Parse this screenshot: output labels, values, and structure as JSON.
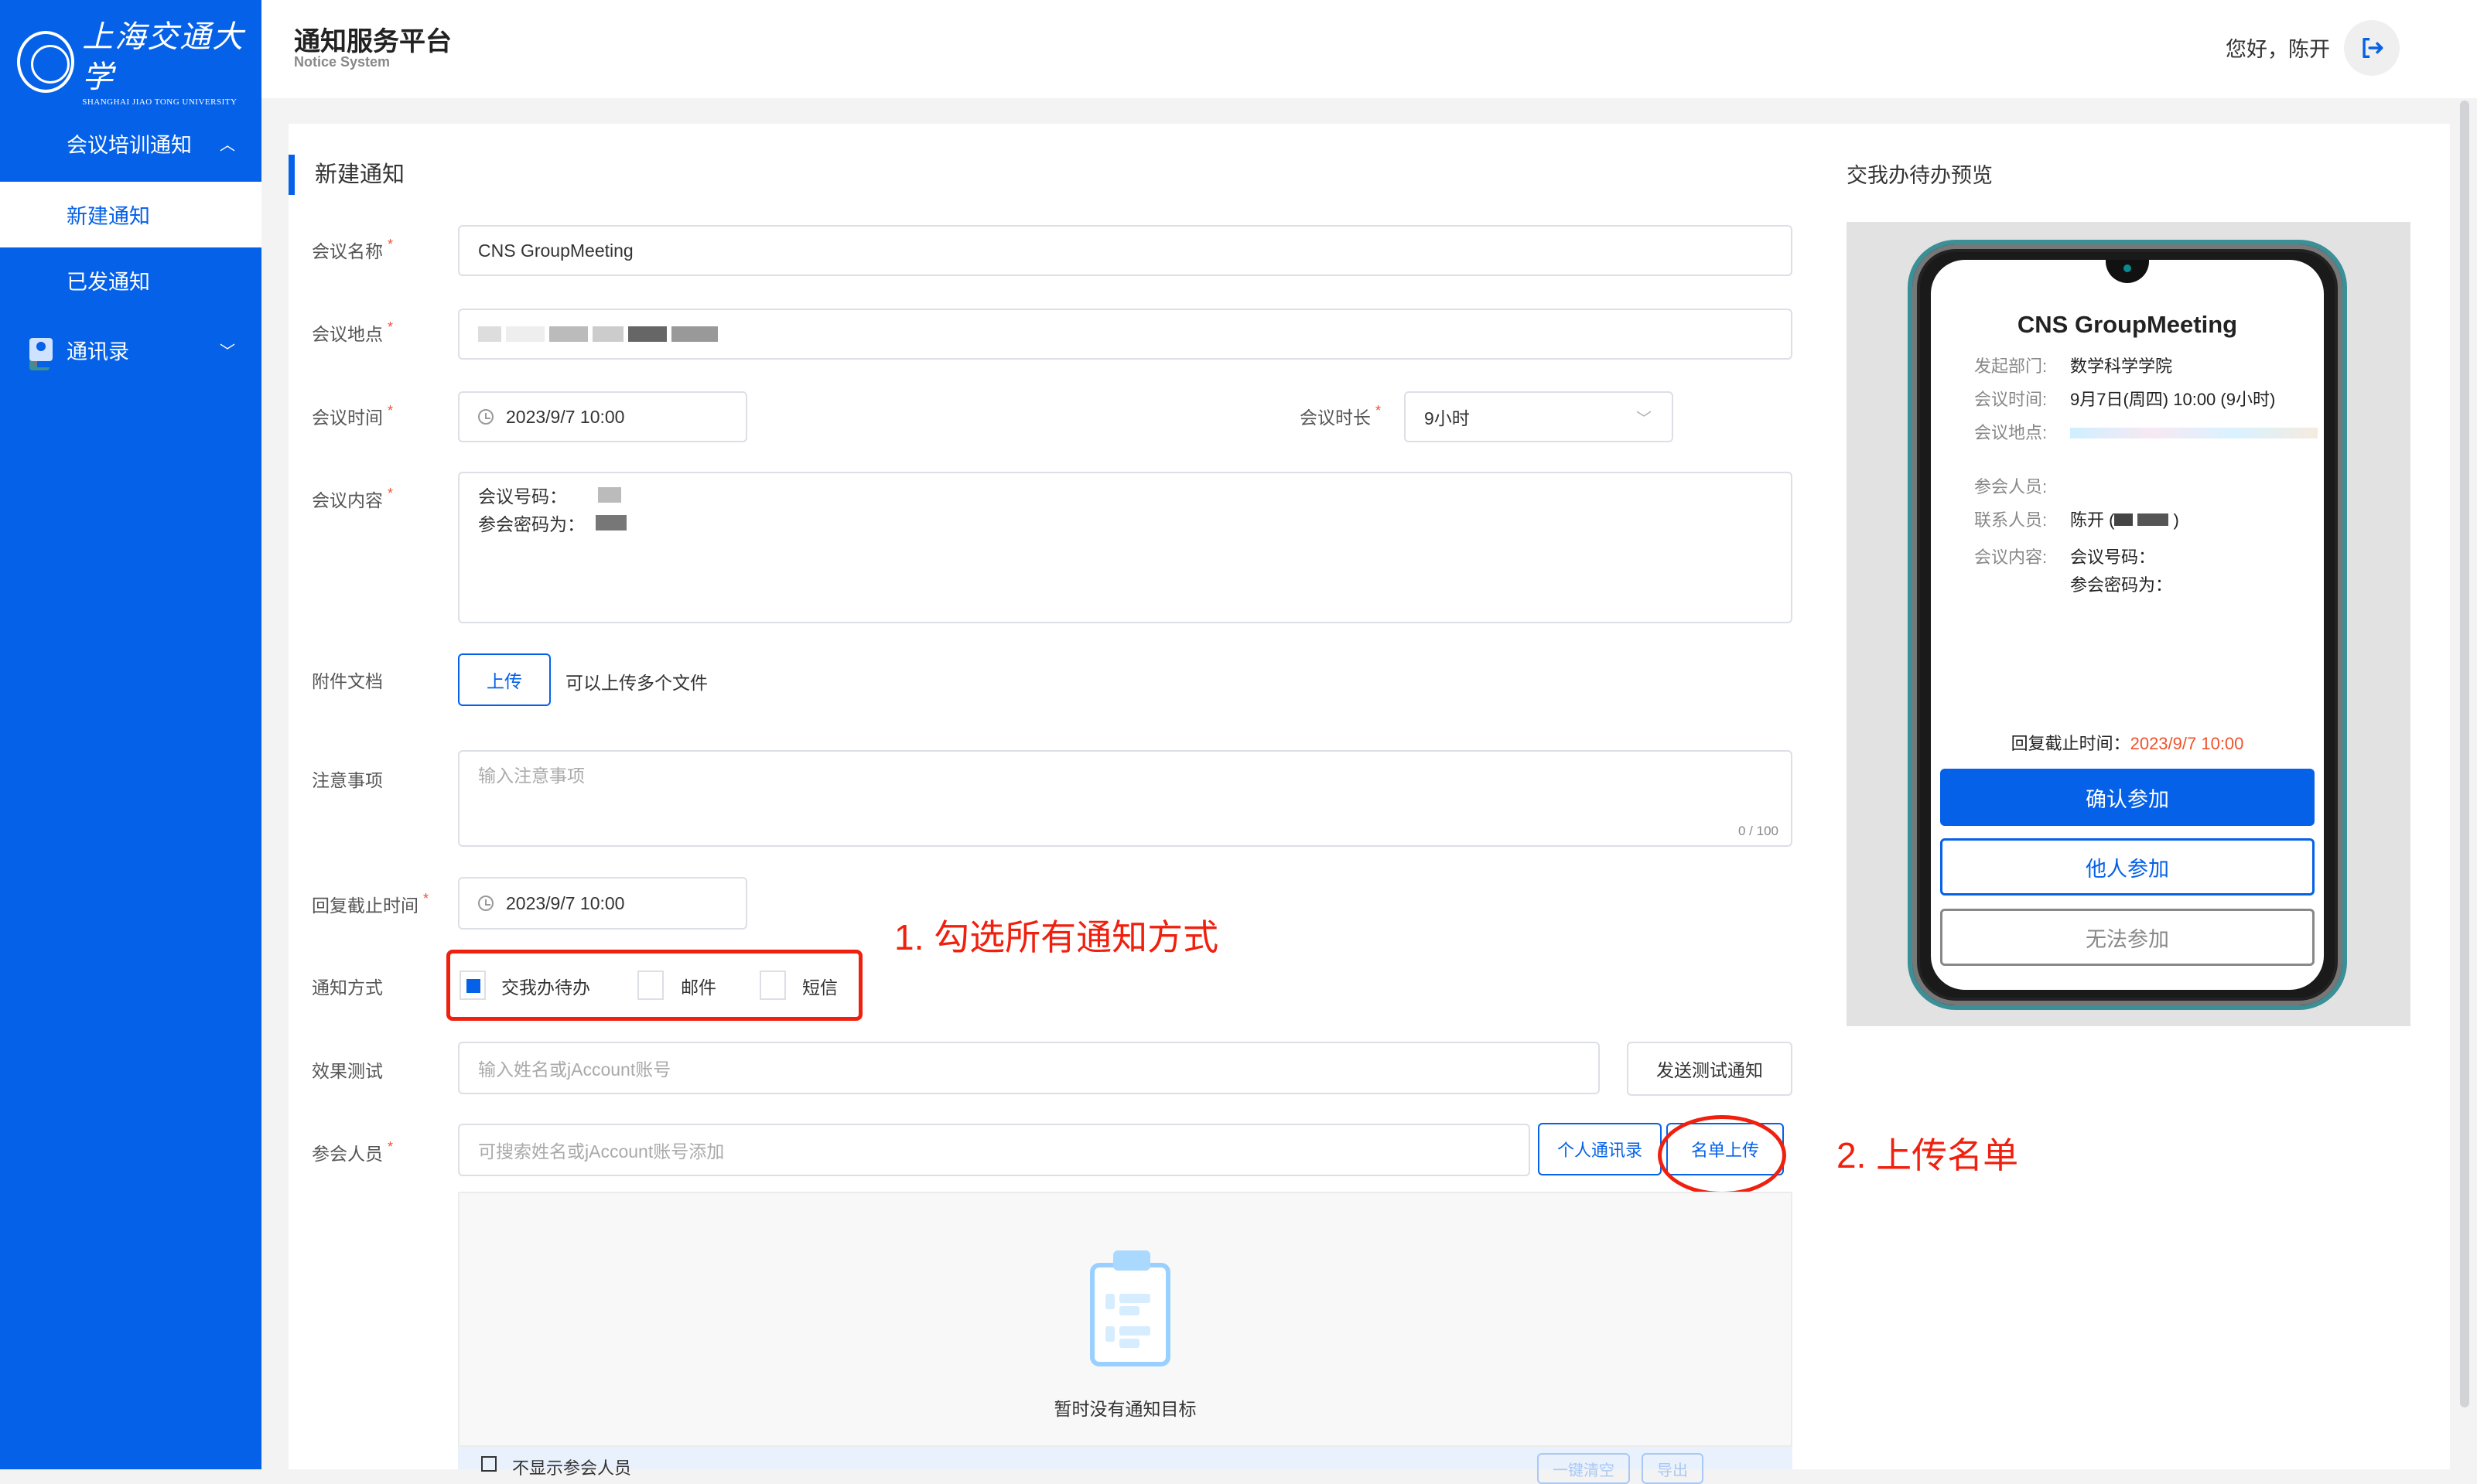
{
  "sidebar": {
    "logo": {
      "cn": "上海交通大学",
      "en": "SHANGHAI JIAO TONG UNIVERSITY"
    },
    "groups": [
      {
        "label": "会议培训通知",
        "icon": "phone-icon",
        "expanded": true,
        "items": [
          {
            "label": "新建通知",
            "active": true
          },
          {
            "label": "已发通知",
            "active": false
          }
        ]
      },
      {
        "label": "通讯录",
        "icon": "contacts-icon",
        "expanded": false
      }
    ]
  },
  "header": {
    "title": "通知服务平台",
    "subtitle": "Notice System",
    "greeting": "您好，陈开",
    "logout_icon": "logout-icon"
  },
  "form": {
    "section_title": "新建通知",
    "name": {
      "label": "会议名称",
      "required": "*",
      "value": "CNS GroupMeeting"
    },
    "location": {
      "label": "会议地点",
      "required": "*",
      "value": "[redacted]"
    },
    "time": {
      "label": "会议时间",
      "required": "*",
      "value": "2023/9/7 10:00"
    },
    "duration": {
      "label": "会议时长",
      "required": "*",
      "value": "9小时"
    },
    "content": {
      "label": "会议内容",
      "required": "*",
      "lines": [
        "会议号码：",
        "参会密码为："
      ]
    },
    "attachment": {
      "label": "附件文档",
      "button": "上传",
      "hint": "可以上传多个文件"
    },
    "notes": {
      "label": "注意事项",
      "placeholder": "输入注意事项",
      "counter": "0 / 100"
    },
    "deadline": {
      "label": "回复截止时间",
      "required": "*",
      "value": "2023/9/7 10:00"
    },
    "methods": {
      "label": "通知方式",
      "options": [
        {
          "label": "交我办待办",
          "checked": true
        },
        {
          "label": "邮件",
          "checked": false
        },
        {
          "label": "短信",
          "checked": false
        }
      ]
    },
    "test": {
      "label": "效果测试",
      "placeholder": "输入姓名或jAccount账号",
      "button": "发送测试通知"
    },
    "attendees": {
      "label": "参会人员",
      "required": "*",
      "placeholder": "可搜索姓名或jAccount账号添加",
      "contacts_button": "个人通讯录",
      "upload_button": "名单上传",
      "empty_text": "暂时没有通知目标",
      "footer_checkbox": "不显示参会人员",
      "clear_button": "一键清空",
      "export_button": "导出"
    }
  },
  "annotations": {
    "step1": "1. 勾选所有通知方式",
    "step2": "2. 上传名单"
  },
  "preview": {
    "title": "交我办待办预览",
    "meeting_title": "CNS GroupMeeting",
    "rows": [
      {
        "key": "发起部门:",
        "value": "数学科学学院"
      },
      {
        "key": "会议时间:",
        "value": "9月7日(周四) 10:00 (9小时)"
      },
      {
        "key": "会议地点:",
        "value": "[redacted link]"
      },
      {
        "key": "参会人员:",
        "value": ""
      },
      {
        "key": "联系人员:",
        "value": "陈开 (redacted)"
      },
      {
        "key": "会议内容:",
        "value": "会议号码："
      }
    ],
    "content_line2": "参会密码为：",
    "deadline_label": "回复截止时间：",
    "deadline_value": "2023/9/7 10:00",
    "buttons": {
      "confirm": "确认参加",
      "other": "他人参加",
      "decline": "无法参加"
    }
  },
  "colors": {
    "brand": "#0561e8",
    "annotation": "#f0200f",
    "deadline": "#f0522a"
  }
}
